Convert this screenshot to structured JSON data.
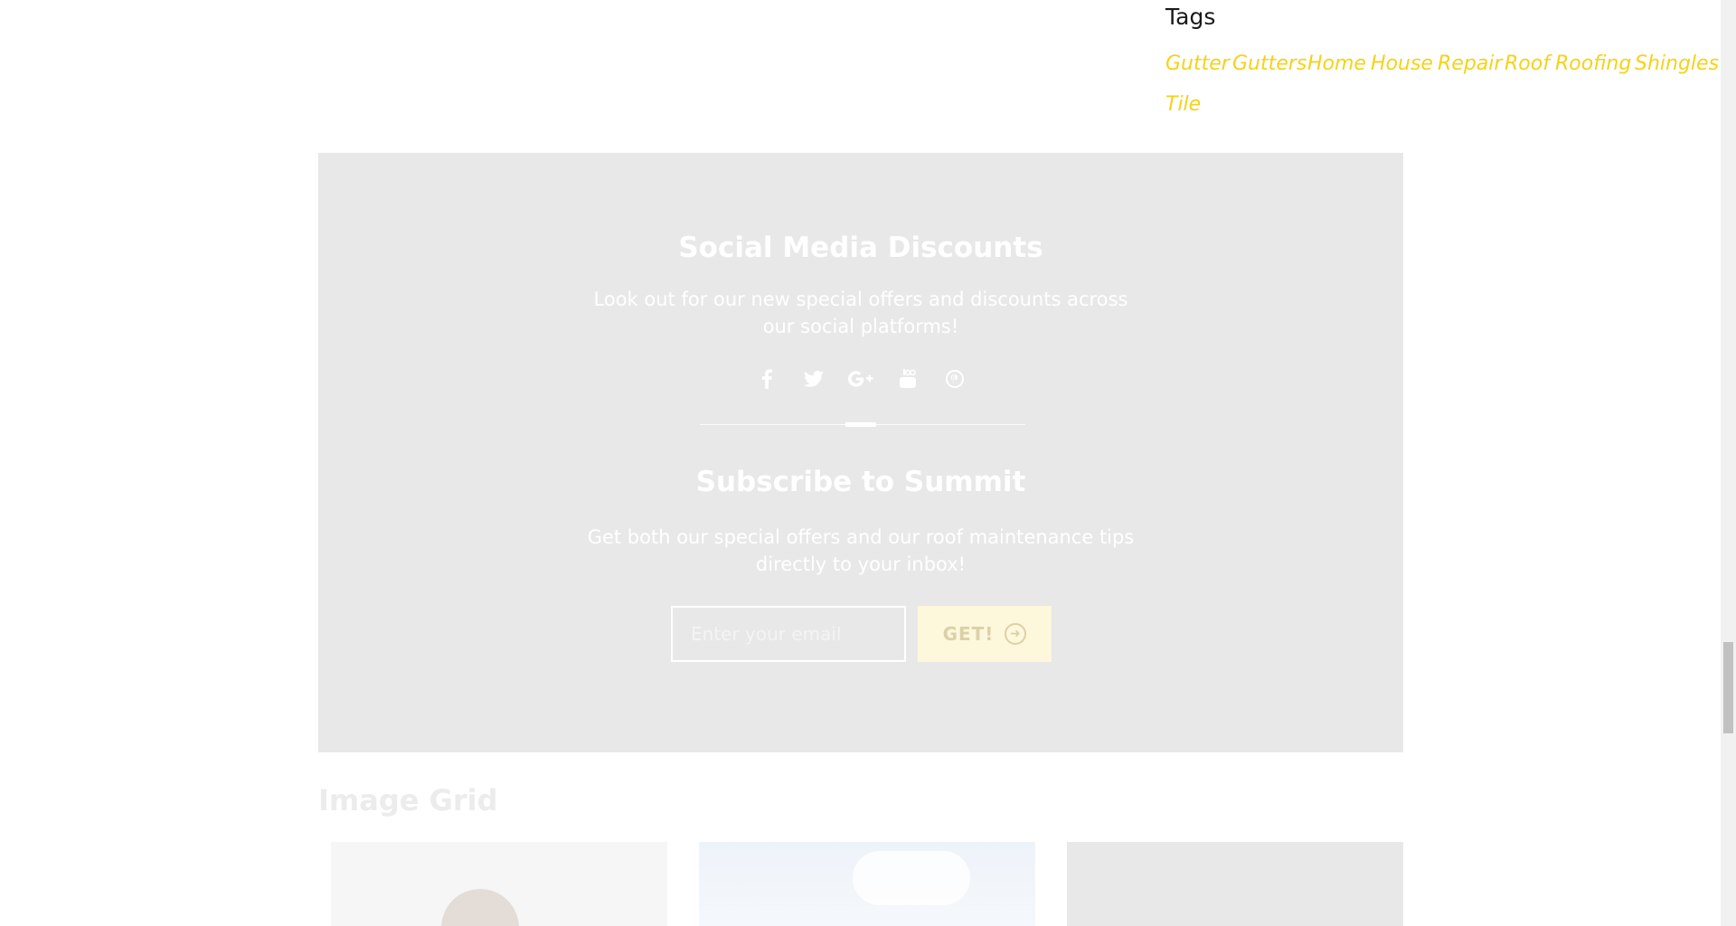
{
  "tags": {
    "title": "Tags",
    "items": [
      "Gutter",
      "Gutters",
      "Home",
      "House",
      "Repair",
      "Roof",
      "Roofing",
      "Shingles",
      "Tile"
    ]
  },
  "social_section": {
    "title": "Social Media Discounts",
    "description": "Look out for our new special offers and discounts across our social platforms!",
    "icons": [
      "facebook-icon",
      "twitter-icon",
      "google-plus-icon",
      "youtube-icon",
      "pinterest-icon"
    ]
  },
  "subscribe": {
    "title": "Subscribe to Summit",
    "description": "Get both our special offers and our roof maintenance tips directly to your inbox!",
    "email_placeholder": "Enter your email",
    "button_label": "GET!"
  },
  "image_grid": {
    "title": "Image Grid"
  },
  "colors": {
    "accent": "#f5d21a",
    "panel_bg": "#e8e8e8",
    "button_bg": "#fdf7dc"
  }
}
